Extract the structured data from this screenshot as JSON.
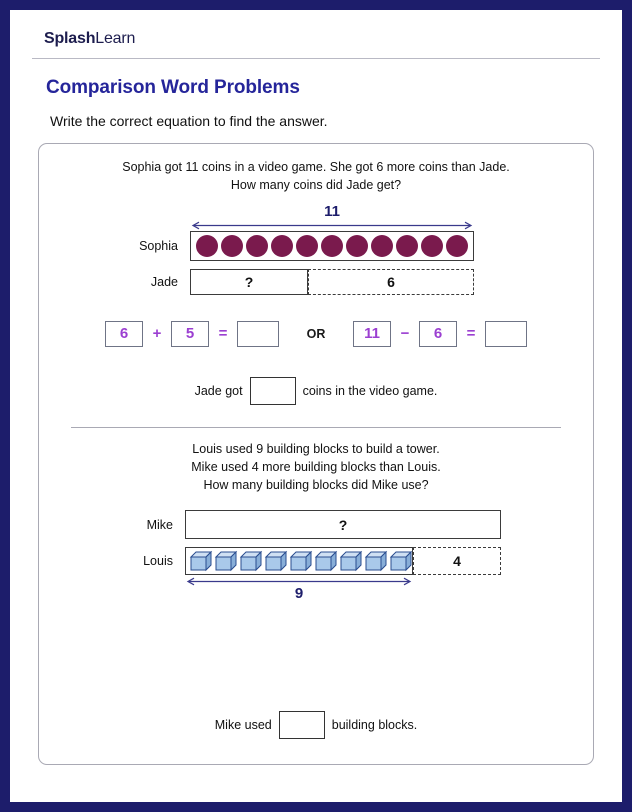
{
  "brand": {
    "bold": "Splash",
    "light": "Learn"
  },
  "header": {
    "title": "Comparison Word Problems",
    "instruction": "Write the correct equation to find the answer."
  },
  "colors": {
    "page_border": "#1d1d6b",
    "title": "#25259a",
    "counter_coin": "#7a1a4d",
    "cube_face": "#a9c9ea",
    "cube_outline": "#2a4d8f",
    "equation_purple": "#9b3fd1",
    "arrow_navy": "#1d1d6b",
    "card_border": "#a9a9b4"
  },
  "problems": [
    {
      "id": "problem-1",
      "text_lines": [
        "Sophia got 11 coins in a video game. She got 6 more coins than Jade.",
        "How many coins did Jade get?"
      ],
      "model": {
        "top_arrow_label": "11",
        "rows": [
          {
            "label": "Sophia",
            "counter_type": "coin",
            "counter_count": 11,
            "segments": []
          },
          {
            "label": "Jade",
            "counter_type": "none",
            "counter_count": 0,
            "segments": [
              {
                "value": "?",
                "style": "solid"
              },
              {
                "value": "6",
                "style": "dashed"
              }
            ]
          }
        ]
      },
      "equations": [
        {
          "id": "equation-left",
          "terms": [
            "6",
            "+",
            "5",
            "=",
            ""
          ],
          "blank_index": 4
        },
        {
          "id": "equation-right",
          "terms": [
            "11",
            "−",
            "6",
            "=",
            ""
          ],
          "blank_index": 4
        }
      ],
      "or_label": "OR",
      "answer_sentence": {
        "before": "Jade got",
        "after": "coins in the video game."
      }
    },
    {
      "id": "problem-2",
      "text_lines": [
        "Louis used 9 building blocks to build a tower.",
        "Mike used 4 more building blocks than Louis.",
        "How many building blocks did Mike use?"
      ],
      "model": {
        "bottom_arrow_label": "9",
        "rows": [
          {
            "label": "Mike",
            "counter_type": "none",
            "counter_count": 0,
            "segments": [
              {
                "value": "?",
                "style": "solid"
              }
            ]
          },
          {
            "label": "Louis",
            "counter_type": "cube",
            "counter_count": 9,
            "segments": [
              {
                "value": "4",
                "style": "dashed"
              }
            ]
          }
        ]
      },
      "answer_sentence": {
        "before": "Mike used",
        "after": "building blocks."
      }
    }
  ]
}
